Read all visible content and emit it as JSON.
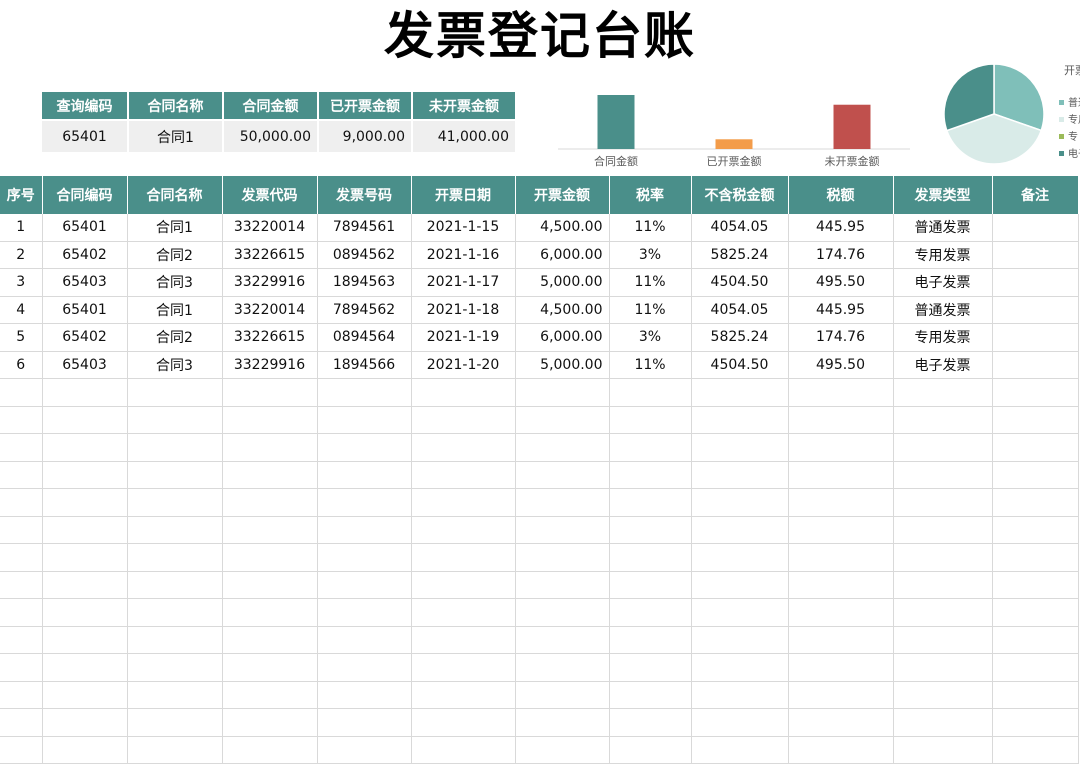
{
  "title": "发票登记台账",
  "summary": {
    "headers": [
      "查询编码",
      "合同名称",
      "合同金额",
      "已开票金额",
      "未开票金额"
    ],
    "row": [
      "65401",
      "合同1",
      "50,000.00",
      "9,000.00",
      "41,000.00"
    ]
  },
  "chart_data": [
    {
      "type": "bar",
      "categories": [
        "合同金额",
        "已开票金额",
        "未开票金额"
      ],
      "values": [
        50000,
        9000,
        41000
      ],
      "colors": [
        "#4a8f8a",
        "#f39c4a",
        "#c0504d"
      ]
    },
    {
      "type": "pie",
      "title": "开票",
      "labels": [
        "普通",
        "专用",
        "专",
        "电子"
      ],
      "values": [
        8995,
        11650,
        0,
        9009
      ],
      "colors": [
        "#7fbfb9",
        "#d9ebe8",
        "#9bbb59",
        "#4a8f8a"
      ]
    }
  ],
  "grid": {
    "headers": [
      "序号",
      "合同编码",
      "合同名称",
      "发票代码",
      "发票号码",
      "开票日期",
      "开票金额",
      "税率",
      "不含税金额",
      "税额",
      "发票类型",
      "备注"
    ],
    "rows": [
      [
        "1",
        "65401",
        "合同1",
        "33220014",
        "7894561",
        "2021-1-15",
        "4,500.00",
        "11%",
        "4054.05",
        "445.95",
        "普通发票",
        ""
      ],
      [
        "2",
        "65402",
        "合同2",
        "33226615",
        "0894562",
        "2021-1-16",
        "6,000.00",
        "3%",
        "5825.24",
        "174.76",
        "专用发票",
        ""
      ],
      [
        "3",
        "65403",
        "合同3",
        "33229916",
        "1894563",
        "2021-1-17",
        "5,000.00",
        "11%",
        "4504.50",
        "495.50",
        "电子发票",
        ""
      ],
      [
        "4",
        "65401",
        "合同1",
        "33220014",
        "7894562",
        "2021-1-18",
        "4,500.00",
        "11%",
        "4054.05",
        "445.95",
        "普通发票",
        ""
      ],
      [
        "5",
        "65402",
        "合同2",
        "33226615",
        "0894564",
        "2021-1-19",
        "6,000.00",
        "3%",
        "5825.24",
        "174.76",
        "专用发票",
        ""
      ],
      [
        "6",
        "65403",
        "合同3",
        "33229916",
        "1894566",
        "2021-1-20",
        "5,000.00",
        "11%",
        "4504.50",
        "495.50",
        "电子发票",
        ""
      ]
    ]
  }
}
